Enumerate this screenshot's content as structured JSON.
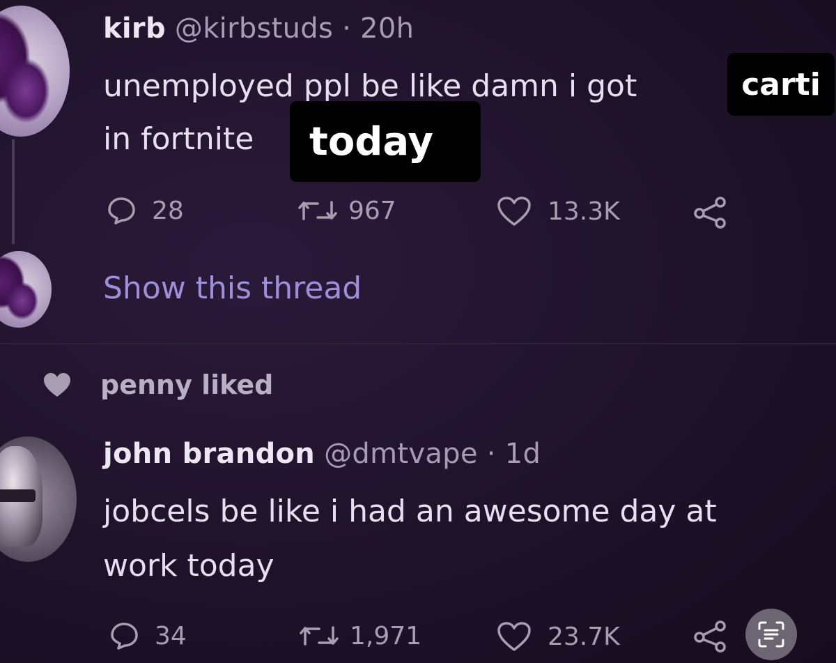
{
  "tweet1": {
    "name": "kirb",
    "handle": "@kirbstuds",
    "separator": "·",
    "time": "20h",
    "line1": "unemployed ppl be like damn i got",
    "line2": "in fortnite",
    "sticker_carti": "carti",
    "sticker_today": "today",
    "replies": "28",
    "retweets": "967",
    "likes": "13.3K"
  },
  "show_thread": "Show this thread",
  "liked_by": "penny liked",
  "tweet2": {
    "name": "john brandon",
    "handle": "@dmtvape",
    "separator": "·",
    "time": "1d",
    "line1": "jobcels be like i had an awesome day at",
    "line2": "work today",
    "replies": "34",
    "retweets": "1,971",
    "likes": "23.7K"
  },
  "colors": {
    "background": "#1e1229",
    "text": "#e8def0",
    "muted": "#a99db2",
    "link": "#9f8fd9",
    "sticker_bg": "#000000"
  },
  "icons": [
    "reply-icon",
    "retweet-icon",
    "like-icon",
    "share-icon",
    "heart-liked-icon",
    "text-scan-icon"
  ]
}
